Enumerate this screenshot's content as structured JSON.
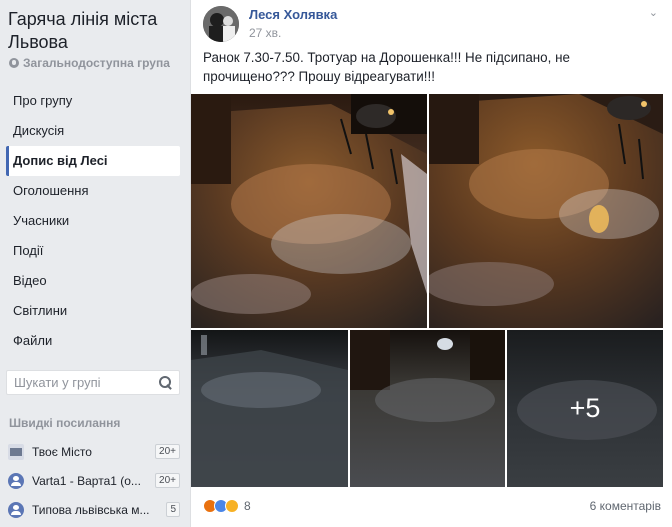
{
  "group": {
    "title": "Гаряча лінія міста Львова",
    "type": "Загальнодоступна група"
  },
  "nav": [
    {
      "label": "Про групу"
    },
    {
      "label": "Дискусія"
    },
    {
      "label": "Допис від Лесі"
    },
    {
      "label": "Оголошення"
    },
    {
      "label": "Учасники"
    },
    {
      "label": "Події"
    },
    {
      "label": "Відео"
    },
    {
      "label": "Світлини"
    },
    {
      "label": "Файли"
    }
  ],
  "search": {
    "placeholder": "Шукати у групі"
  },
  "quick_links": {
    "title": "Швидкі посилання",
    "items": [
      {
        "label": "Твоє Місто",
        "badge": "20+"
      },
      {
        "label": "Varta1 - Варта1 (о...",
        "badge": "20+"
      },
      {
        "label": "Типова львівська м...",
        "badge": "5"
      }
    ]
  },
  "post": {
    "author": "Леся Холявка",
    "time": "27 хв.",
    "text": "Ранок 7.30-7.50. Тротуар на Дорошенка!!! Не підсипано, не прочищено??? Прошу відреагувати!!!",
    "more_photos": "+5",
    "reaction_count": "8",
    "comments": "6 коментарів"
  },
  "colors": {
    "link": "#365899",
    "accent": "#4267b2"
  }
}
